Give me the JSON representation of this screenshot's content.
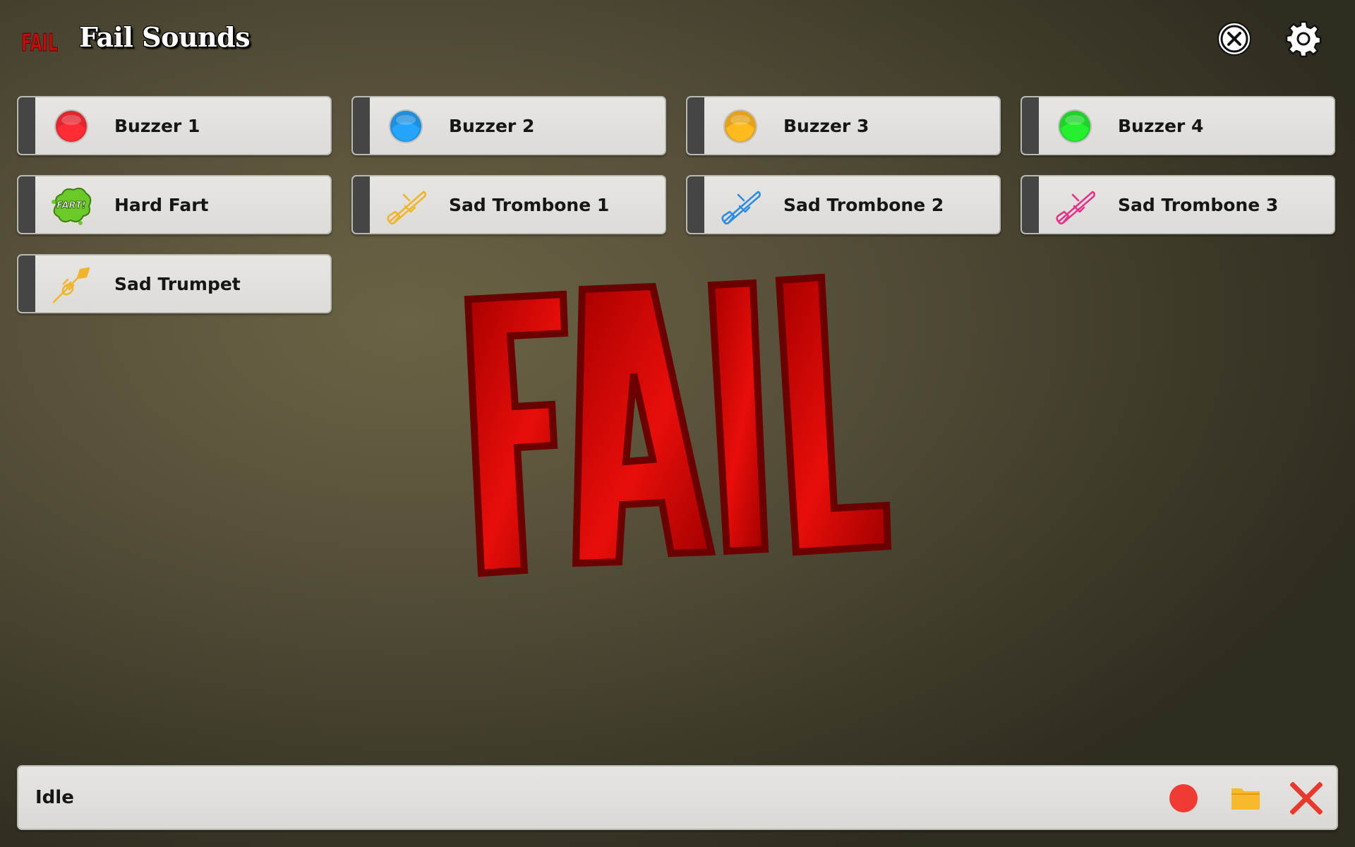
{
  "app": {
    "title": "Fail Sounds",
    "logo_text": "FAIL",
    "logo_icon": "fail-logo-icon"
  },
  "header": {
    "close_icon": "close-circle-icon",
    "settings_icon": "gear-icon"
  },
  "sounds": [
    {
      "label": "Buzzer 1",
      "icon": "red-buzzer-icon",
      "color": "#e0262f"
    },
    {
      "label": "Buzzer 2",
      "icon": "blue-buzzer-icon",
      "color": "#1f8fdc"
    },
    {
      "label": "Buzzer 3",
      "icon": "orange-buzzer-icon",
      "color": "#e3a21a"
    },
    {
      "label": "Buzzer 4",
      "icon": "green-buzzer-icon",
      "color": "#1fd12a"
    },
    {
      "label": "Hard Fart",
      "icon": "fart-cloud-icon",
      "color": "#6cc92a",
      "icon_text": "FART!"
    },
    {
      "label": "Sad Trombone 1",
      "icon": "trombone-icon",
      "color": "#f0b52b"
    },
    {
      "label": "Sad Trombone 2",
      "icon": "trombone-icon",
      "color": "#2e8de0"
    },
    {
      "label": "Sad Trombone 3",
      "icon": "trombone-icon",
      "color": "#e2348a"
    },
    {
      "label": "Sad Trumpet",
      "icon": "trumpet-icon",
      "color": "#f0b52b"
    }
  ],
  "hero": {
    "text": "FAIL",
    "fill": "#d0120f",
    "stroke": "#650000"
  },
  "status_bar": {
    "status": "Idle",
    "record_icon": "record-icon",
    "folder_icon": "folder-icon",
    "clear_icon": "close-x-icon",
    "record_color": "#f03b34",
    "folder_color": "#f8b92c",
    "clear_color": "#e8392f"
  }
}
